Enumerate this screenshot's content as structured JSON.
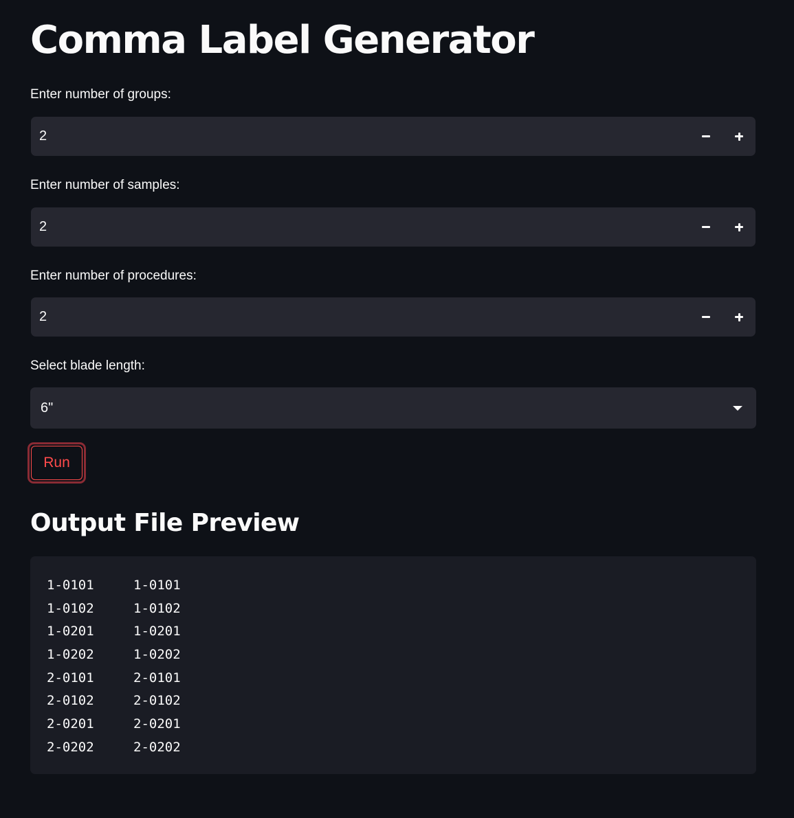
{
  "title": "Comma Label Generator",
  "fields": [
    {
      "label": "Enter number of groups:",
      "value": "2"
    },
    {
      "label": "Enter number of samples:",
      "value": "2"
    },
    {
      "label": "Enter number of procedures:",
      "value": "2"
    }
  ],
  "blade": {
    "label": "Select blade length:",
    "selected": "6\""
  },
  "run_button": "Run",
  "preview": {
    "heading": "Output File Preview",
    "rows": [
      [
        "1-0101",
        "1-0101"
      ],
      [
        "1-0102",
        "1-0102"
      ],
      [
        "1-0201",
        "1-0201"
      ],
      [
        "1-0202",
        "1-0202"
      ],
      [
        "2-0101",
        "2-0101"
      ],
      [
        "2-0102",
        "2-0102"
      ],
      [
        "2-0201",
        "2-0201"
      ],
      [
        "2-0202",
        "2-0202"
      ]
    ]
  },
  "colors": {
    "background": "#0e1117",
    "input_background": "#262730",
    "code_background": "#1a1c24",
    "accent": "#ff4b4b",
    "text": "#fafafa"
  }
}
